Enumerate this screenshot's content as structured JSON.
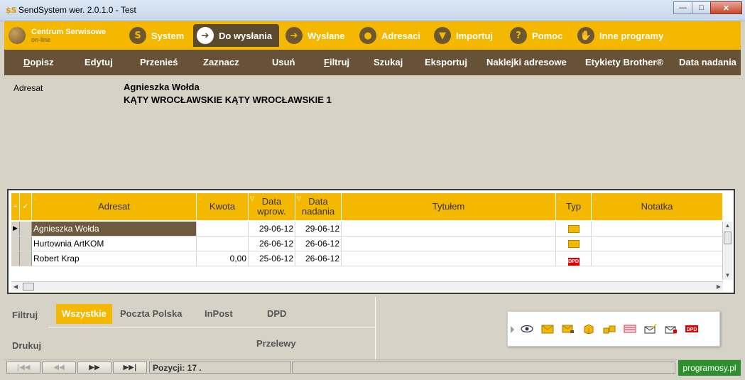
{
  "window": {
    "title": "SendSystem wer. 2.0.1.0 -  Test",
    "logo": "$S"
  },
  "tabs": {
    "brand": {
      "line1": "Centrum Serwisowe",
      "line2": "on-line"
    },
    "items": [
      {
        "label": "System",
        "icon": "S"
      },
      {
        "label": "Do wysłania",
        "icon": "➔"
      },
      {
        "label": "Wysłane",
        "icon": "➔"
      },
      {
        "label": "Adresaci",
        "icon": "●"
      },
      {
        "label": "Importuj",
        "icon": "▼"
      },
      {
        "label": "Pomoc",
        "icon": "?"
      },
      {
        "label": "Inne programy",
        "icon": "✋"
      }
    ]
  },
  "toolbar": [
    "Dopisz",
    "Edytuj",
    "Przenieś",
    "Zaznacz",
    "Usuń",
    "Filtruj",
    "Szukaj",
    "Eksportuj",
    "Naklejki adresowe",
    "Etykiety Brother®",
    "Data nadania"
  ],
  "detail": {
    "label": "Adresat",
    "name": "Agnieszka Wołda",
    "address": "KĄTY WROCŁAWSKIE KĄTY WROCŁAWSKIE 1"
  },
  "grid": {
    "columns": {
      "adresat": "Adresat",
      "kwota": "Kwota",
      "data_wprow_1": "Data",
      "data_wprow_2": "wprow.",
      "data_nad_1": "Data",
      "data_nad_2": "nadania",
      "tytulem": "Tytułem",
      "typ": "Typ",
      "notatka": "Notatka"
    },
    "rows": [
      {
        "adresat": "Agnieszka Wołda",
        "kwota": "",
        "data_wprow": "29-06-12",
        "data_nadania": "29-06-12",
        "tytulem": "",
        "typ": "envelope-icon",
        "notatka": ""
      },
      {
        "adresat": "Hurtownia ArtKOM",
        "kwota": "",
        "data_wprow": "26-06-12",
        "data_nadania": "26-06-12",
        "tytulem": "",
        "typ": "envelope-icon",
        "notatka": ""
      },
      {
        "adresat": "Robert Krap",
        "kwota": "0,00",
        "data_wprow": "25-06-12",
        "data_nadania": "26-06-12",
        "tytulem": "",
        "typ": "DPD",
        "notatka": ""
      }
    ]
  },
  "filter": {
    "label": "Filtruj",
    "tabs": [
      "Wszystkie",
      "Poczta Polska",
      "InPost",
      "DPD"
    ],
    "active": "Wszystkie"
  },
  "print": {
    "label": "Drukuj",
    "przelewy": "Przelewy"
  },
  "status": {
    "nav": [
      "|◀◀",
      "◀◀",
      "▶▶",
      "▶▶|"
    ],
    "pozycji": "Pozycji: 17 .",
    "badge": "programosy.pl"
  },
  "colors": {
    "accent": "#f5b800",
    "toolbar": "#675237",
    "panel": "#d6d2c5"
  }
}
